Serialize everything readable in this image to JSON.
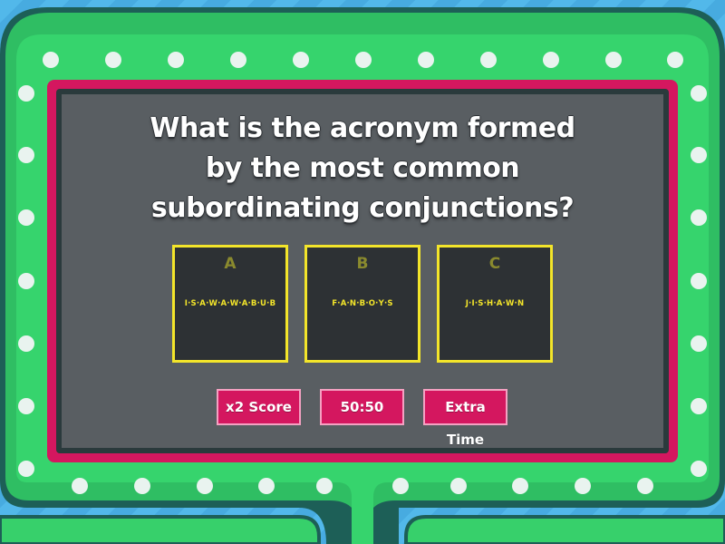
{
  "question": "What is the acronym formed by the most common subordinating conjunctions?",
  "answers": [
    {
      "letter": "A",
      "text": "I·S·A·W·A·W·A·B·U·B"
    },
    {
      "letter": "B",
      "text": "F·A·N·B·O·Y·S"
    },
    {
      "letter": "C",
      "text": "J·I·S·H·A·W·N"
    }
  ],
  "powerups": [
    {
      "label": "x2 Score"
    },
    {
      "label": "50:50"
    },
    {
      "label": "Extra Time"
    }
  ],
  "colors": {
    "background": "#4fb3e6",
    "frame_outer": "#2bb35b",
    "frame_border": "#1f6e5e",
    "frame_band": "#32d56c",
    "screen_border": "#d4175f",
    "screen": "#595e62",
    "card": "#2d3134",
    "card_accent": "#f3e52a",
    "powerup": "#d4175f"
  }
}
